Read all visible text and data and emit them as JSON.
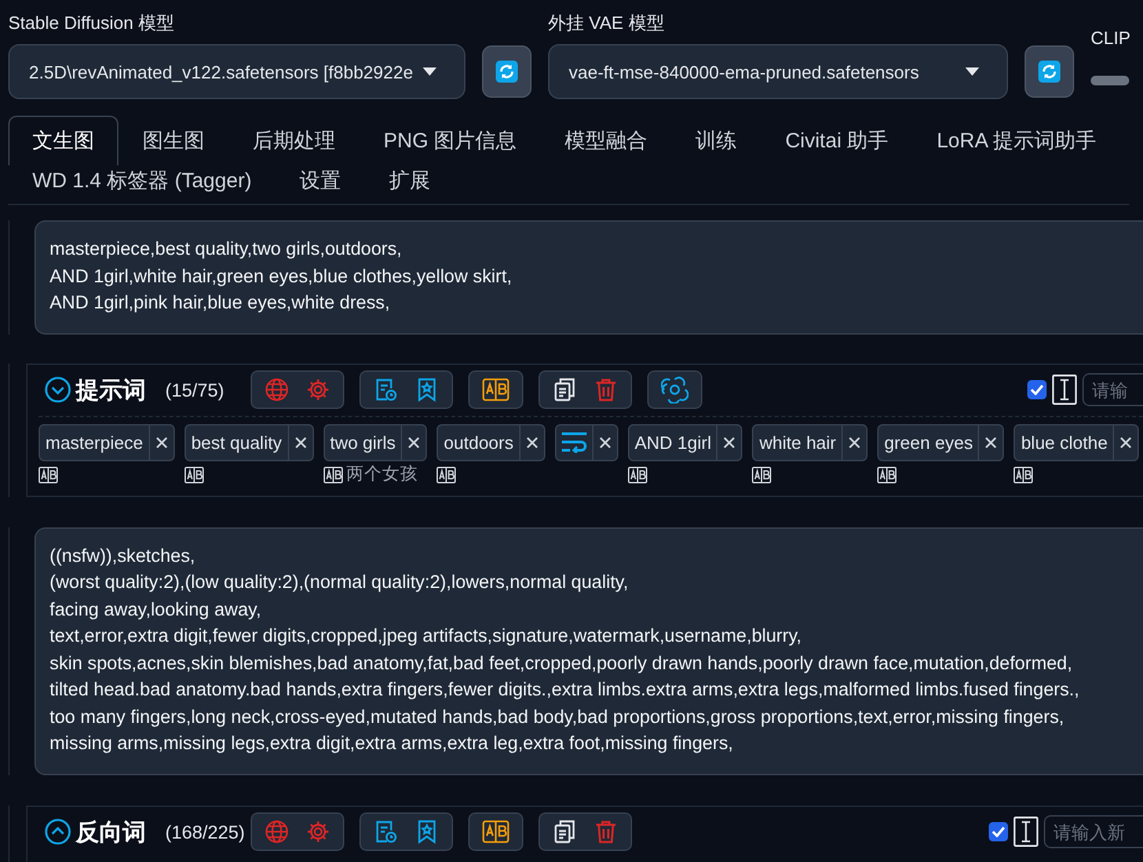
{
  "models": [
    {
      "label": "Stable Diffusion 模型",
      "value": "2.5D\\revAnimated_v122.safetensors [f8bb2922e"
    },
    {
      "label": "外挂 VAE 模型",
      "value": "vae-ft-mse-840000-ema-pruned.safetensors"
    }
  ],
  "clip": {
    "label": "CLIP"
  },
  "tabs": [
    {
      "label": "文生图",
      "selected": true
    },
    {
      "label": "图生图",
      "selected": false
    },
    {
      "label": "后期处理",
      "selected": false
    },
    {
      "label": "PNG 图片信息",
      "selected": false
    },
    {
      "label": "模型融合",
      "selected": false
    },
    {
      "label": "训练",
      "selected": false
    },
    {
      "label": "Civitai 助手",
      "selected": false
    },
    {
      "label": "LoRA 提示词助手",
      "selected": false
    },
    {
      "label": "WD 1.4 标签器 (Tagger)",
      "selected": false
    },
    {
      "label": "设置",
      "selected": false
    },
    {
      "label": "扩展",
      "selected": false
    }
  ],
  "prompt": {
    "text": "masterpiece,best quality,two girls,outdoors,\nAND 1girl,white hair,green eyes,blue clothes,yellow skirt,\nAND 1girl,pink hair,blue eyes,white dress,",
    "panel": {
      "title": "提示词",
      "count": "(15/75)",
      "expanded": true,
      "assistant_button": true,
      "checked": true,
      "placeholder": "请输",
      "tags": [
        {
          "kind": "text",
          "text": "masterpiece"
        },
        {
          "kind": "text",
          "text": "best quality"
        },
        {
          "kind": "text",
          "text": "two girls",
          "translation": "两个女孩"
        },
        {
          "kind": "text",
          "text": "outdoors"
        },
        {
          "kind": "linebreak"
        },
        {
          "kind": "text",
          "text": "AND 1girl"
        },
        {
          "kind": "text",
          "text": "white hair"
        },
        {
          "kind": "text",
          "text": "green eyes"
        },
        {
          "kind": "text",
          "text": "blue clothe"
        }
      ]
    }
  },
  "negative_prompt": {
    "text": "((nsfw)),sketches,\n(worst quality:2),(low quality:2),(normal quality:2),lowers,normal quality,\nfacing away,looking away,\ntext,error,extra digit,fewer digits,cropped,jpeg artifacts,signature,watermark,username,blurry,\nskin spots,acnes,skin blemishes,bad anatomy,fat,bad feet,cropped,poorly drawn hands,poorly drawn face,mutation,deformed,\ntilted head.bad anatomy.bad hands,extra fingers,fewer digits.,extra limbs.extra arms,extra legs,malformed limbs.fused fingers.,\ntoo many fingers,long neck,cross-eyed,mutated hands,bad body,bad proportions,gross proportions,text,error,missing fingers,\nmissing arms,missing legs,extra digit,extra arms,extra leg,extra foot,missing fingers,",
    "panel": {
      "title": "反向词",
      "count": "(168/225)",
      "expanded": false,
      "assistant_button": false,
      "checked": true,
      "placeholder": "请输入新"
    }
  }
}
